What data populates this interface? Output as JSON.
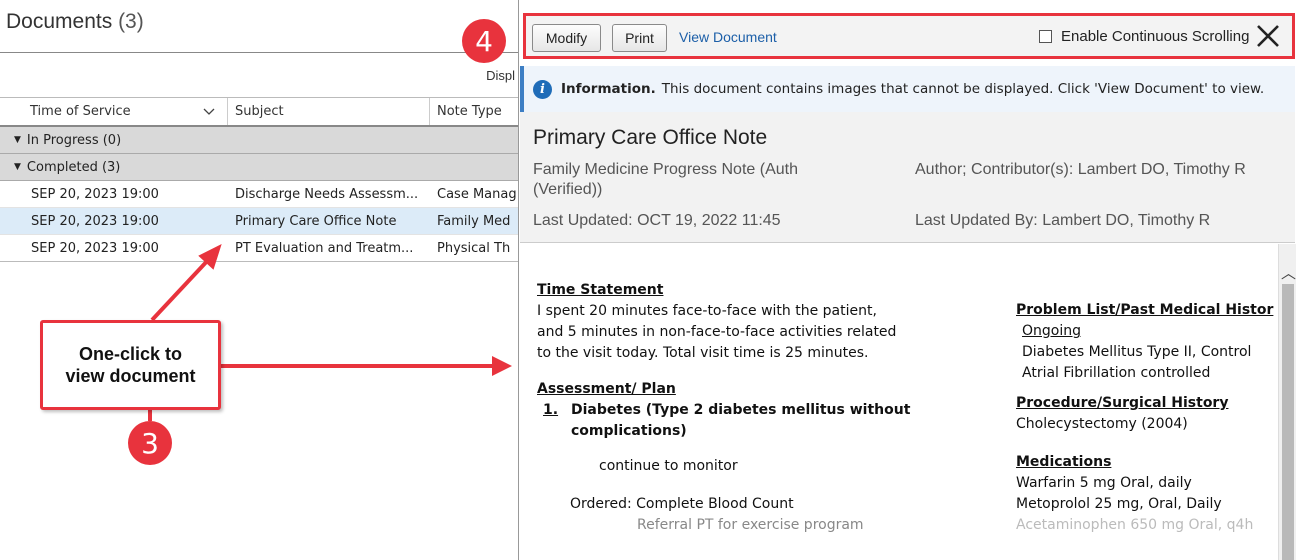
{
  "left": {
    "title": "Documents",
    "count": "(3)",
    "display_label": "Displ",
    "columns": [
      "Time of Service",
      "Subject",
      "Note Type"
    ],
    "groups": [
      {
        "label": "In Progress (0)"
      },
      {
        "label": "Completed (3)"
      }
    ],
    "rows": [
      {
        "time": "SEP 20, 2023 19:00",
        "subject": "Discharge Needs Assessm...",
        "type": "Case Manag"
      },
      {
        "time": "SEP 20, 2023 19:00",
        "subject": "Primary Care Office Note",
        "type": "Family Med"
      },
      {
        "time": "SEP 20, 2023 19:00",
        "subject": "PT Evaluation and Treatm...",
        "type": "Physical Th"
      }
    ]
  },
  "toolbar": {
    "modify": "Modify",
    "print": "Print",
    "view_document": "View Document",
    "continuous": "Enable Continuous Scrolling"
  },
  "info": {
    "label": "Information.",
    "text": "This document contains images that cannot be displayed. Click 'View Document' to view."
  },
  "header": {
    "title": "Primary Care Office Note",
    "subtitle": "Family Medicine Progress Note (Auth (Verified))",
    "author": "Author; Contributor(s): Lambert DO, Timothy R",
    "last_updated": "Last Updated: OCT 19, 2022 11:45",
    "last_updated_by": "Last Updated By: Lambert DO, Timothy R"
  },
  "doc": {
    "time_statement_heading": "Time Statement",
    "time_statement": [
      "I spent 20 minutes face-to-face with the patient,",
      "and 5 minutes in non-face-to-face activities related",
      "to the visit today. Total visit time is 25 minutes."
    ],
    "assessment_heading": "Assessment/ Plan",
    "item_number": "1.",
    "item_title": [
      "Diabetes (Type 2 diabetes mellitus without",
      "complications)"
    ],
    "item_note": "continue to monitor",
    "ordered": "Ordered: Complete Blood Count",
    "referral": "Referral PT for exercise program",
    "problem_heading": "Problem List/Past Medical Histor",
    "ongoing": "Ongoing",
    "problems": [
      "Diabetes Mellitus Type II, Control",
      "Atrial Fibrillation controlled"
    ],
    "procedure_heading": "Procedure/Surgical History",
    "procedure": "Cholecystectomy  (2004)",
    "medications_heading": "Medications",
    "medications": [
      "Warfarin 5 mg Oral, daily",
      "Metoprolol 25 mg, Oral, Daily",
      "Acetaminophen 650 mg Oral, q4h"
    ]
  },
  "annotations": {
    "badge_4": "4",
    "badge_3": "3",
    "callout": [
      "One-click to",
      "view document"
    ]
  },
  "colors": {
    "accent_red": "#e8333d",
    "link_blue": "#1c5fa8",
    "selected_row": "#dcebf8",
    "info_blue": "#1f6cb8"
  },
  "icons": [
    "close-icon",
    "info-icon",
    "sort-chevron-icon",
    "group-collapse-icon",
    "scroll-up-icon"
  ]
}
